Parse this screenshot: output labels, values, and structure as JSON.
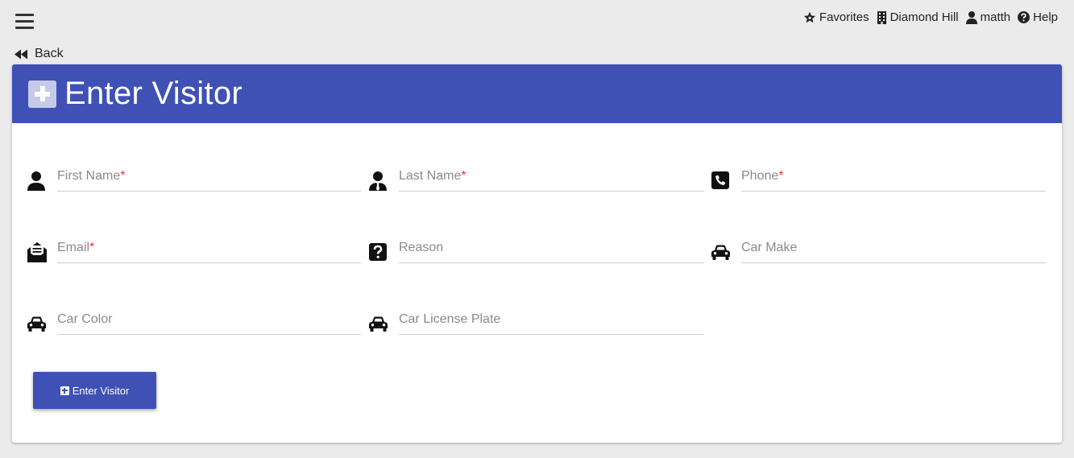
{
  "topnav": {
    "favorites": "Favorites",
    "building": "Diamond Hill",
    "user": "matth",
    "help": "Help"
  },
  "back_label": "Back",
  "page_title": "Enter Visitor",
  "fields": {
    "first_name": {
      "label": "First Name",
      "required": "*",
      "icon": "user-icon"
    },
    "last_name": {
      "label": "Last Name",
      "required": "*",
      "icon": "user-tie-icon"
    },
    "phone": {
      "label": "Phone",
      "required": "*",
      "icon": "phone-square-icon"
    },
    "email": {
      "label": "Email",
      "required": "*",
      "icon": "envelope-open-text-icon"
    },
    "reason": {
      "label": "Reason",
      "icon": "question-square-icon"
    },
    "car_make": {
      "label": "Car Make",
      "icon": "car-icon"
    },
    "car_color": {
      "label": "Car Color",
      "icon": "car-icon"
    },
    "car_plate": {
      "label": "Car License Plate",
      "icon": "car-icon"
    }
  },
  "submit_label": "Enter Visitor",
  "colors": {
    "primary": "#3f51b5",
    "background": "#ebebeb",
    "required": "#e53935",
    "label": "#8a8a8a"
  }
}
